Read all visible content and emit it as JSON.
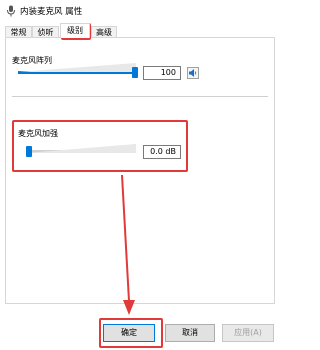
{
  "window": {
    "title": "内装麦克风 属性"
  },
  "tabs": [
    {
      "label": "常规"
    },
    {
      "label": "侦听"
    },
    {
      "label": "级别"
    },
    {
      "label": "高级"
    }
  ],
  "mic_array": {
    "label": "麦克风阵列",
    "value_text": "100",
    "level": 100
  },
  "mic_boost": {
    "label": "麦克风加强",
    "value_text": "0.0 dB",
    "level": 0
  },
  "buttons": {
    "ok": "确定",
    "cancel": "取消",
    "apply": "应用(A)"
  },
  "colors": {
    "accent": "#0078d7",
    "annotation": "#e03a3a"
  }
}
